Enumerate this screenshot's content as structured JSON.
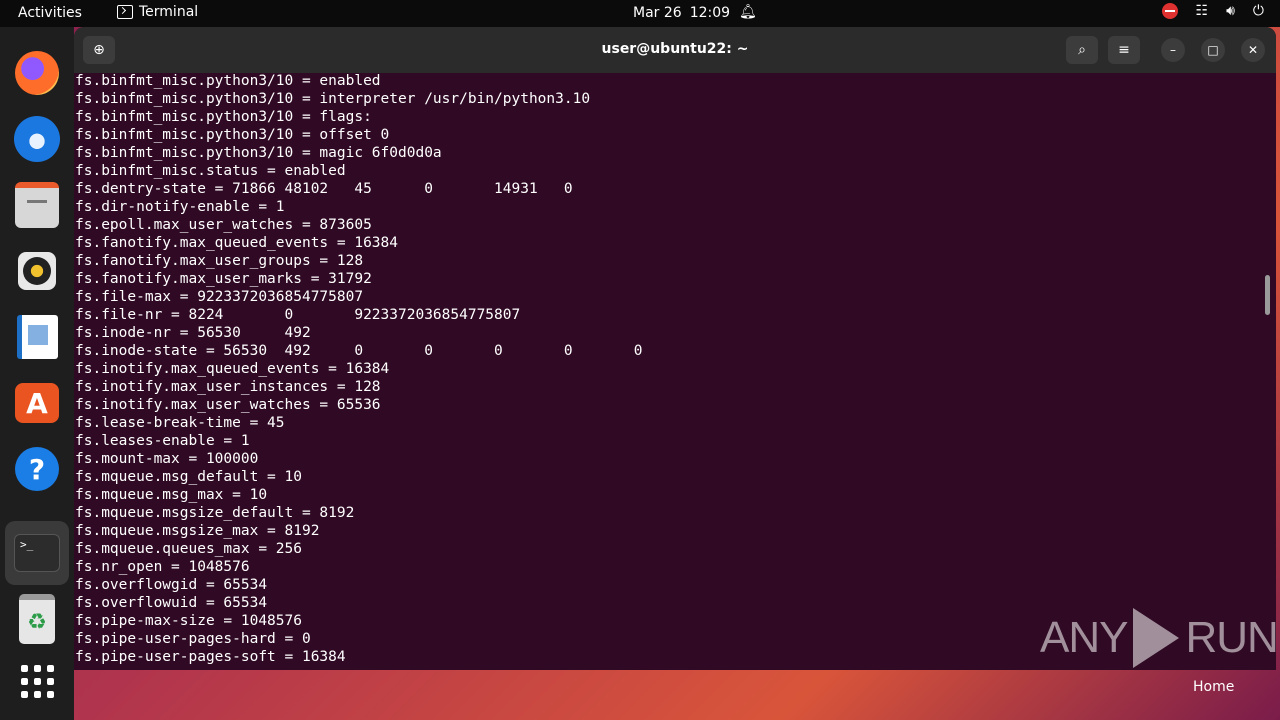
{
  "topbar": {
    "activities": "Activities",
    "app_name": "Terminal",
    "date": "Mar 26",
    "time": "12:09"
  },
  "dock": {
    "items": [
      {
        "name": "firefox"
      },
      {
        "name": "thunderbird"
      },
      {
        "name": "files"
      },
      {
        "name": "rhythmbox"
      },
      {
        "name": "libreoffice-writer"
      },
      {
        "name": "ubuntu-software"
      },
      {
        "name": "help"
      },
      {
        "name": "terminal",
        "active": true
      },
      {
        "name": "trash"
      },
      {
        "name": "show-applications"
      }
    ]
  },
  "window": {
    "title": "user@ubuntu22: ~"
  },
  "terminal": {
    "lines": [
      "fs.binfmt_misc.python3/10 = enabled",
      "fs.binfmt_misc.python3/10 = interpreter /usr/bin/python3.10",
      "fs.binfmt_misc.python3/10 = flags:",
      "fs.binfmt_misc.python3/10 = offset 0",
      "fs.binfmt_misc.python3/10 = magic 6f0d0d0a",
      "fs.binfmt_misc.status = enabled",
      "fs.dentry-state = 71866 48102   45      0       14931   0",
      "fs.dir-notify-enable = 1",
      "fs.epoll.max_user_watches = 873605",
      "fs.fanotify.max_queued_events = 16384",
      "fs.fanotify.max_user_groups = 128",
      "fs.fanotify.max_user_marks = 31792",
      "fs.file-max = 9223372036854775807",
      "fs.file-nr = 8224       0       9223372036854775807",
      "fs.inode-nr = 56530     492",
      "fs.inode-state = 56530  492     0       0       0       0       0",
      "fs.inotify.max_queued_events = 16384",
      "fs.inotify.max_user_instances = 128",
      "fs.inotify.max_user_watches = 65536",
      "fs.lease-break-time = 45",
      "fs.leases-enable = 1",
      "fs.mount-max = 100000",
      "fs.mqueue.msg_default = 10",
      "fs.mqueue.msg_max = 10",
      "fs.mqueue.msgsize_default = 8192",
      "fs.mqueue.msgsize_max = 8192",
      "fs.mqueue.queues_max = 256",
      "fs.nr_open = 1048576",
      "fs.overflowgid = 65534",
      "fs.overflowuid = 65534",
      "fs.pipe-max-size = 1048576",
      "fs.pipe-user-pages-hard = 0",
      "fs.pipe-user-pages-soft = 16384"
    ]
  },
  "watermark": {
    "left": "ANY",
    "right": "RUN"
  },
  "desktop": {
    "home_label": "Home"
  }
}
